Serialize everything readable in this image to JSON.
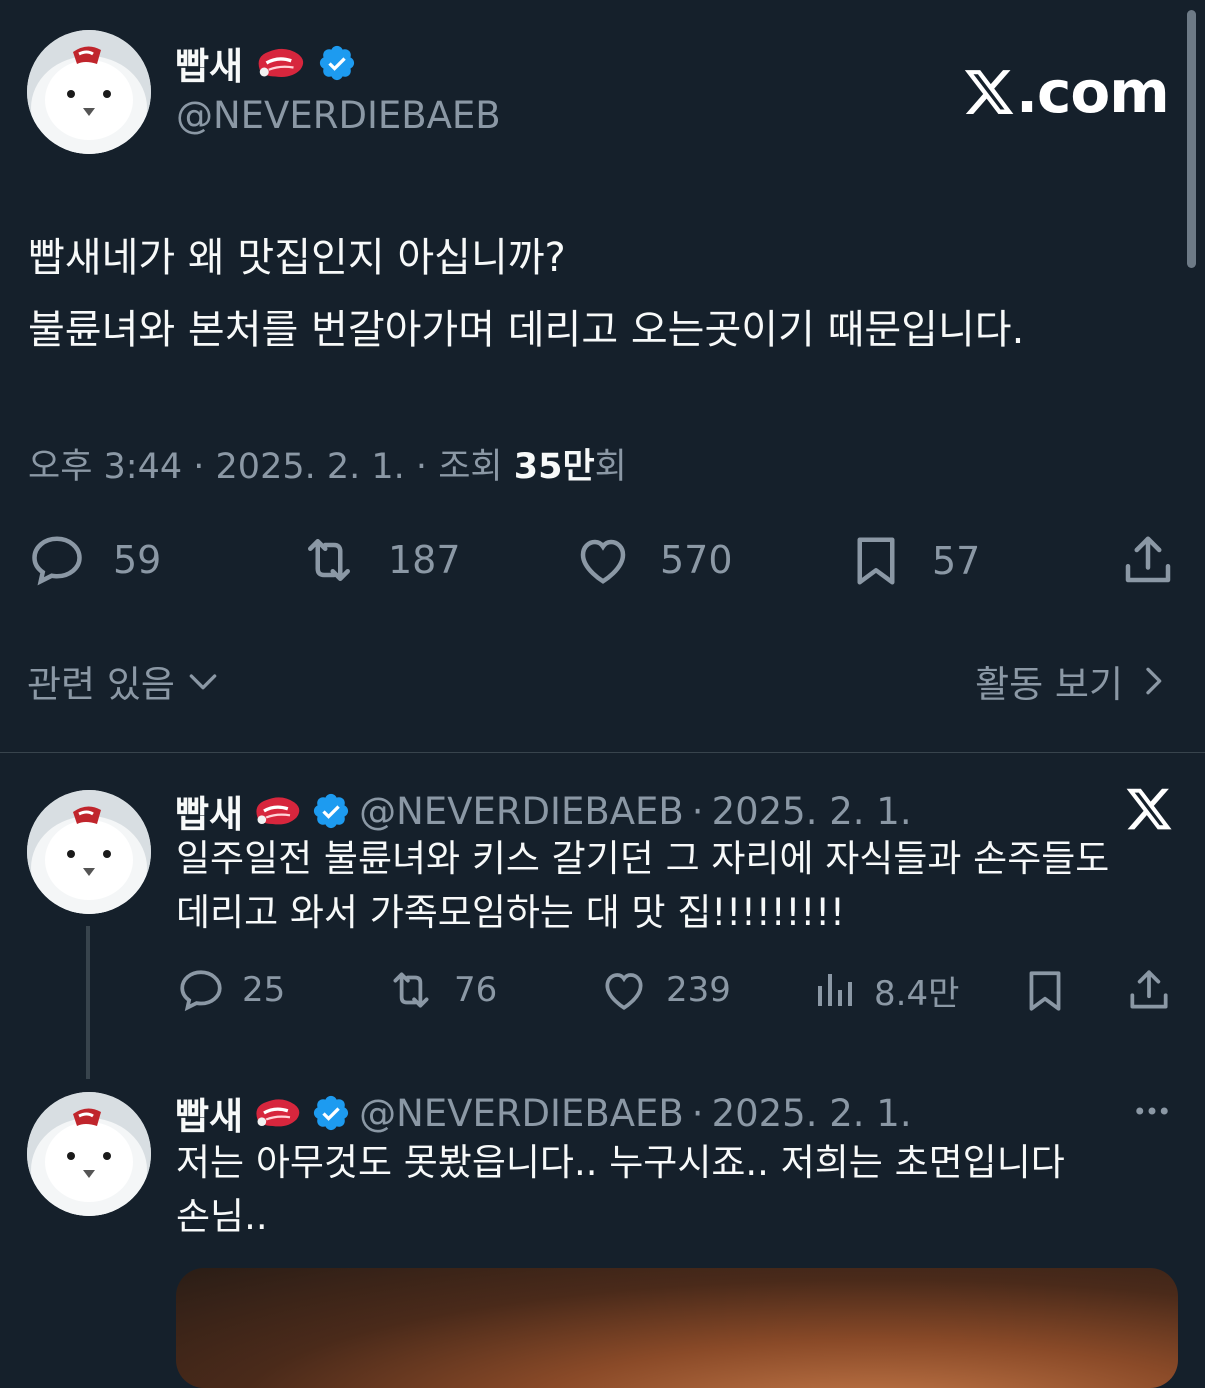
{
  "main_tweet": {
    "author_name": "빱새",
    "author_handle": "@NEVERDIEBAEB",
    "brand_label": ".com",
    "text_lines": [
      "빱새네가 왜 맛집인지 아십니까?",
      "불륜녀와 본처를 번갈아가며 데리고 오는곳이기 때문입니다."
    ],
    "time": "오후 3:44",
    "date": "2025. 2. 1.",
    "views_label": "조회",
    "views_count": "35만",
    "views_suffix": "회",
    "stats": {
      "replies": "59",
      "retweets": "187",
      "likes": "570",
      "bookmarks": "57"
    },
    "related_label": "관련 있음",
    "activity_label": "활동 보기"
  },
  "replies": [
    {
      "author_name": "빱새",
      "author_handle": "@NEVERDIEBAEB",
      "date": "2025. 2. 1.",
      "text_lines": [
        "일주일전 불륜녀와 키스 갈기던 그 자리에 자식들과 손주들도",
        "데리고 와서 가족모임하는 대 맛 집!!!!!!!!!"
      ],
      "stats": {
        "replies": "25",
        "retweets": "76",
        "likes": "239",
        "views": "8.4만"
      }
    },
    {
      "author_name": "빱새",
      "author_handle": "@NEVERDIEBAEB",
      "date": "2025. 2. 1.",
      "text_lines": [
        "저는 아무것도 못봤읍니다.. 누구시죠.. 저희는 초면입니다",
        "손님.."
      ]
    }
  ],
  "colors": {
    "background": "#15202b",
    "text": "#e7e9ea",
    "muted": "#8b98a5",
    "verified": "#1d9bf0",
    "divider": "#38444d"
  }
}
